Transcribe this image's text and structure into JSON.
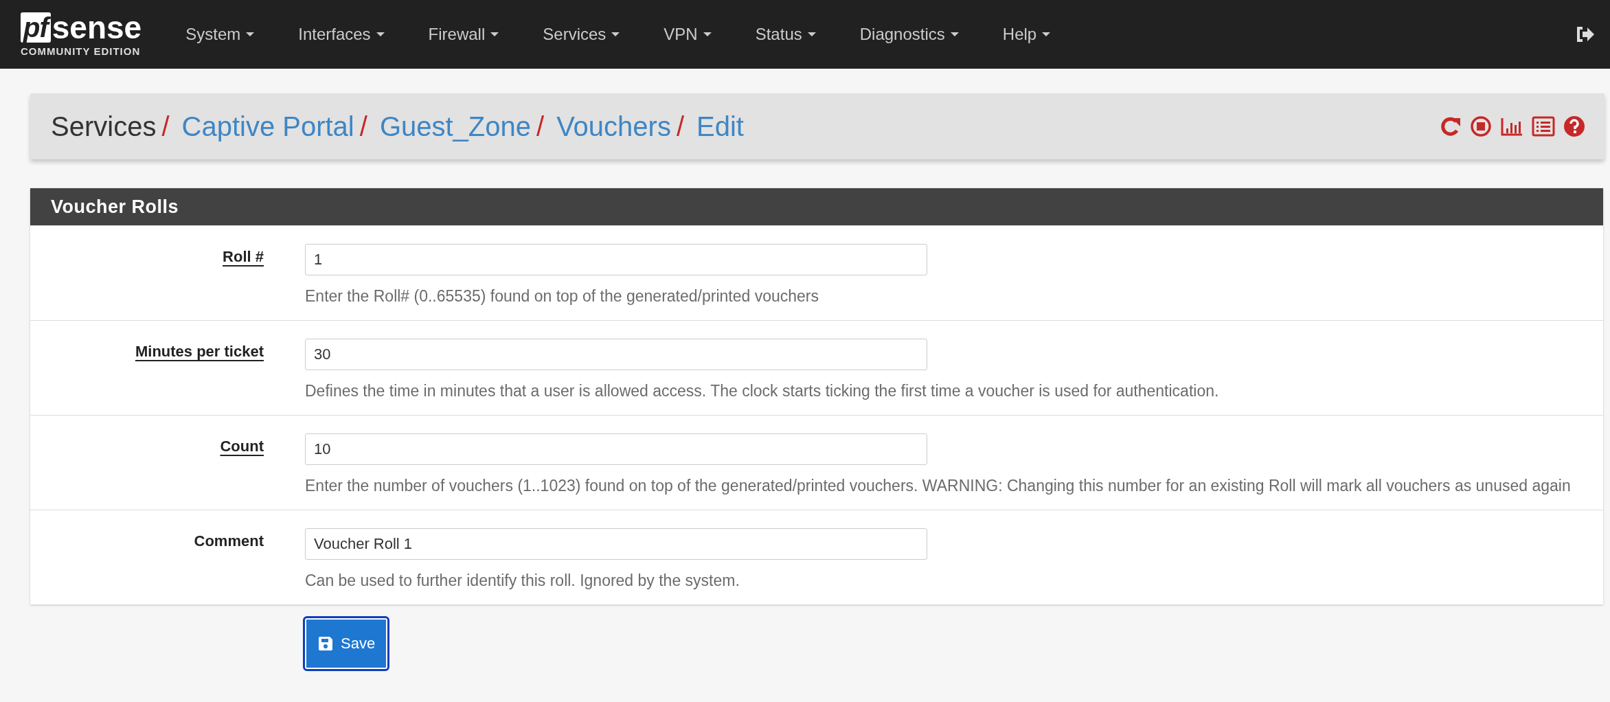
{
  "logo": {
    "mark": "pf",
    "word": "sense",
    "edition": "COMMUNITY EDITION"
  },
  "nav": [
    {
      "label": "System"
    },
    {
      "label": "Interfaces"
    },
    {
      "label": "Firewall"
    },
    {
      "label": "Services"
    },
    {
      "label": "VPN"
    },
    {
      "label": "Status"
    },
    {
      "label": "Diagnostics"
    },
    {
      "label": "Help"
    }
  ],
  "breadcrumb": [
    {
      "label": "Services",
      "link": false,
      "separator": "/"
    },
    {
      "label": "Captive Portal",
      "link": true,
      "separator": "/"
    },
    {
      "label": "Guest_Zone",
      "link": true,
      "separator": "/"
    },
    {
      "label": "Vouchers",
      "link": true,
      "separator": "/"
    },
    {
      "label": "Edit",
      "link": true
    }
  ],
  "header_actions": [
    {
      "kind": "restart"
    },
    {
      "kind": "stop"
    },
    {
      "kind": "chart"
    },
    {
      "kind": "log"
    },
    {
      "kind": "help"
    }
  ],
  "panel": {
    "title": "Voucher Rolls",
    "rows": [
      {
        "label": "Roll #",
        "required": true,
        "value": "1",
        "help": "Enter the Roll# (0..65535) found on top of the generated/printed vouchers"
      },
      {
        "label": "Minutes per ticket",
        "required": true,
        "value": "30",
        "help": "Defines the time in minutes that a user is allowed access. The clock starts ticking the first time a voucher is used for authentication."
      },
      {
        "label": "Count",
        "required": true,
        "value": "10",
        "help": "Enter the number of vouchers (1..1023) found on top of the generated/printed vouchers. WARNING: Changing this number for an existing Roll will mark all vouchers as unused again"
      },
      {
        "label": "Comment",
        "required": false,
        "value": "Voucher Roll 1",
        "help": "Can be used to further identify this roll. Ignored by the system."
      }
    ]
  },
  "save_button": {
    "label": "Save"
  }
}
